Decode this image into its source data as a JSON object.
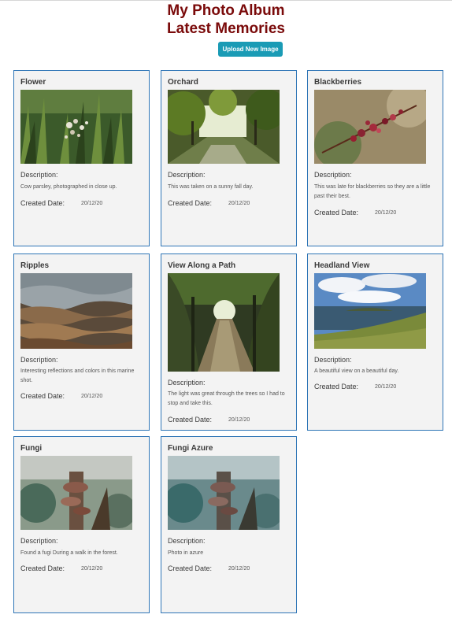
{
  "header": {
    "title": "My Photo Album",
    "subtitle": "Latest Memories",
    "upload_label": "Upload New Image"
  },
  "labels": {
    "description": "Description:",
    "created_date": "Created Date:"
  },
  "cards": [
    {
      "title": "Flower",
      "description": "Cow parsley, photographed in close up.",
      "date": "20/12/20"
    },
    {
      "title": "Orchard",
      "description": "This was taken on a sunny fall day.",
      "date": "20/12/20"
    },
    {
      "title": "Blackberries",
      "description": "This was late for blackberries so they are a little past their best.",
      "date": "20/12/20"
    },
    {
      "title": "Ripples",
      "description": "Interesting reflections and colors in this marine shot.",
      "date": "20/12/20"
    },
    {
      "title": "View Along a Path",
      "description": "The light was great through the trees so I had to stop and take this.",
      "date": "20/12/20"
    },
    {
      "title": "Headland View",
      "description": "A beautiful view on a beautiful day.",
      "date": "20/12/20"
    },
    {
      "title": "Fungi",
      "description": "Found a fugi During a walk in the forest.",
      "date": "20/12/20"
    },
    {
      "title": "Fungi Azure",
      "description": "Photo in azure",
      "date": "20/12/20"
    }
  ]
}
